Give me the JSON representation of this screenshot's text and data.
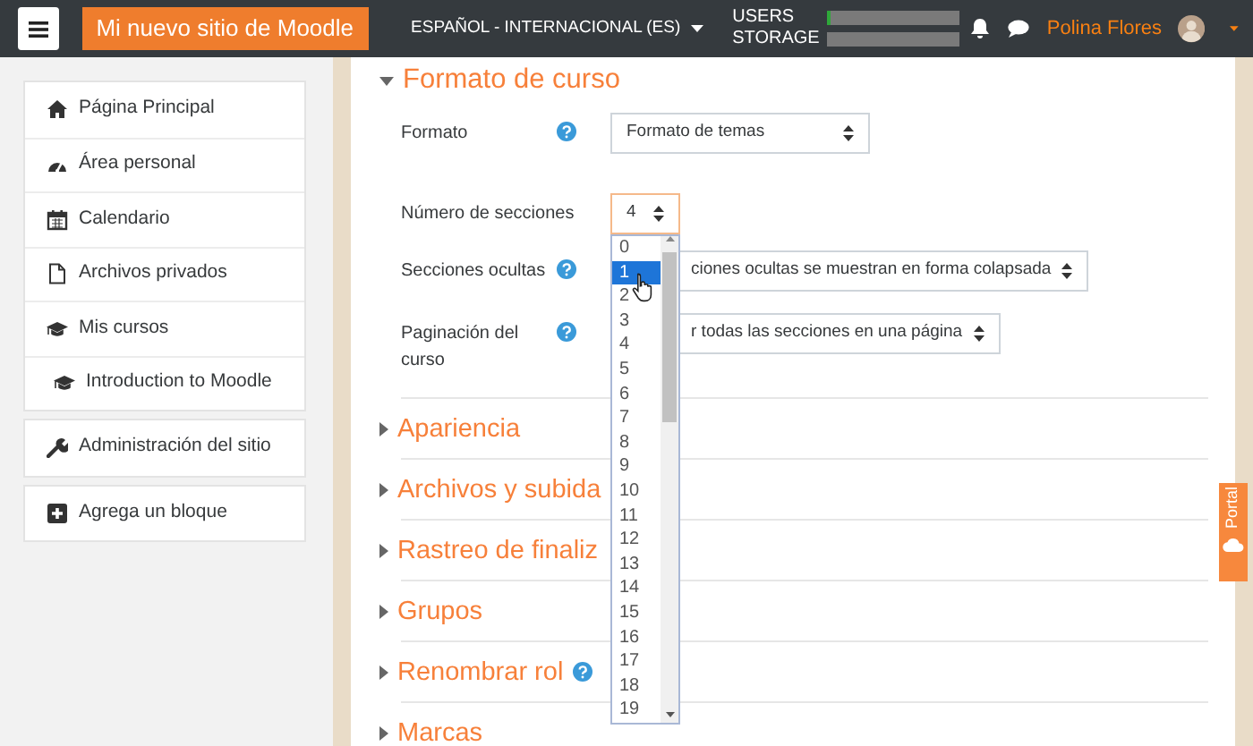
{
  "navbar": {
    "brand": "Mi nuevo sitio de Moodle",
    "language": "ESPAÑOL - INTERNACIONAL (ES)",
    "quotas": [
      {
        "label": "USERS",
        "level": 0.03
      },
      {
        "label": "STORAGE",
        "level": 0
      }
    ],
    "user": {
      "name": "Polina Flores"
    }
  },
  "sidebar": {
    "blocks": [
      {
        "items": [
          {
            "label": "Página Principal"
          },
          {
            "label": "Área personal"
          },
          {
            "label": "Calendario"
          },
          {
            "label": "Archivos privados"
          },
          {
            "label": "Mis cursos",
            "children": [
              {
                "label": "Introduction to Moodle"
              }
            ]
          }
        ]
      },
      {
        "items": [
          {
            "label": "Administración del sitio"
          }
        ]
      },
      {
        "items": [
          {
            "label": "Agrega un bloque"
          }
        ]
      }
    ]
  },
  "form": {
    "section": {
      "title": "Formato de curso",
      "expanded": true
    },
    "fields": [
      {
        "label": "Formato",
        "help": true,
        "value": "Formato de temas",
        "focused": false
      },
      {
        "label": "Número de secciones",
        "help": false,
        "value": "4",
        "focused": true
      },
      {
        "label": "Secciones ocultas",
        "help": true,
        "value": "ciones ocultas se muestran en forma colapsada",
        "focused": false
      },
      {
        "label": "Paginación del curso",
        "help": true,
        "value": "r todas las secciones en una página",
        "focused": false
      }
    ],
    "sections": [
      {
        "title": "Apariencia",
        "expanded": false,
        "help": false
      },
      {
        "title": "Archivos y subida",
        "expanded": false,
        "help": false
      },
      {
        "title": "Rastreo de finaliz",
        "expanded": false,
        "help": false
      },
      {
        "title": "Grupos",
        "expanded": false,
        "help": false
      },
      {
        "title": "Renombrar rol",
        "expanded": false,
        "help": true
      },
      {
        "title": "Marcas",
        "expanded": false,
        "help": false
      }
    ]
  },
  "dropdown": {
    "options": [
      {
        "label": "0",
        "selected": false
      },
      {
        "label": "1",
        "selected": true
      },
      {
        "label": "2",
        "selected": false
      },
      {
        "label": "3",
        "selected": false
      },
      {
        "label": "4",
        "selected": false
      },
      {
        "label": "5",
        "selected": false
      },
      {
        "label": "6",
        "selected": false
      },
      {
        "label": "7",
        "selected": false
      },
      {
        "label": "8",
        "selected": false
      },
      {
        "label": "9",
        "selected": false
      },
      {
        "label": "10",
        "selected": false
      },
      {
        "label": "11",
        "selected": false
      },
      {
        "label": "12",
        "selected": false
      },
      {
        "label": "13",
        "selected": false
      },
      {
        "label": "14",
        "selected": false
      },
      {
        "label": "15",
        "selected": false
      },
      {
        "label": "16",
        "selected": false
      },
      {
        "label": "17",
        "selected": false
      },
      {
        "label": "18",
        "selected": false
      },
      {
        "label": "19",
        "selected": false
      }
    ]
  },
  "portal_tab": {
    "label": "Portal"
  }
}
